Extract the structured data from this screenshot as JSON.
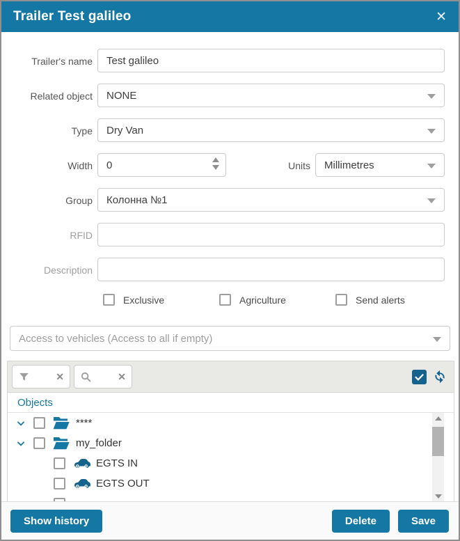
{
  "dialog": {
    "title": "Trailer Test galileo",
    "close_icon": "✕"
  },
  "form": {
    "trailers_name": {
      "label": "Trailer's name",
      "value": "Test galileo"
    },
    "related_object": {
      "label": "Related object",
      "value": "NONE"
    },
    "type": {
      "label": "Type",
      "value": "Dry Van"
    },
    "width": {
      "label": "Width",
      "value": "0"
    },
    "units": {
      "label": "Units",
      "value": "Millimetres"
    },
    "group": {
      "label": "Group",
      "value": "Колонна №1"
    },
    "rfid": {
      "label": "RFID",
      "value": ""
    },
    "description": {
      "label": "Description",
      "value": ""
    },
    "checkboxes": [
      {
        "label": "Exclusive",
        "checked": false
      },
      {
        "label": "Agriculture",
        "checked": false
      },
      {
        "label": "Send alerts",
        "checked": false
      }
    ]
  },
  "access": {
    "placeholder": "Access to vehicles (Access to all if empty)"
  },
  "vehicle_panel": {
    "filter_clear": "✕",
    "search_clear": "✕",
    "select_all_checked": true,
    "objects_header": "Objects",
    "tree": [
      {
        "label": "****",
        "type": "folder",
        "level": 0,
        "expanded": true,
        "checked": false
      },
      {
        "label": "my_folder",
        "type": "folder",
        "level": 0,
        "expanded": true,
        "checked": false
      },
      {
        "label": "EGTS IN",
        "type": "vehicle",
        "level": 1,
        "checked": false
      },
      {
        "label": "EGTS OUT",
        "type": "vehicle",
        "level": 1,
        "checked": false
      }
    ]
  },
  "footer": {
    "show_history": "Show history",
    "delete": "Delete",
    "save": "Save"
  },
  "colors": {
    "primary": "#1577a3",
    "icon_blue": "#15628c",
    "toolbar_bg": "#e9e9e6"
  }
}
